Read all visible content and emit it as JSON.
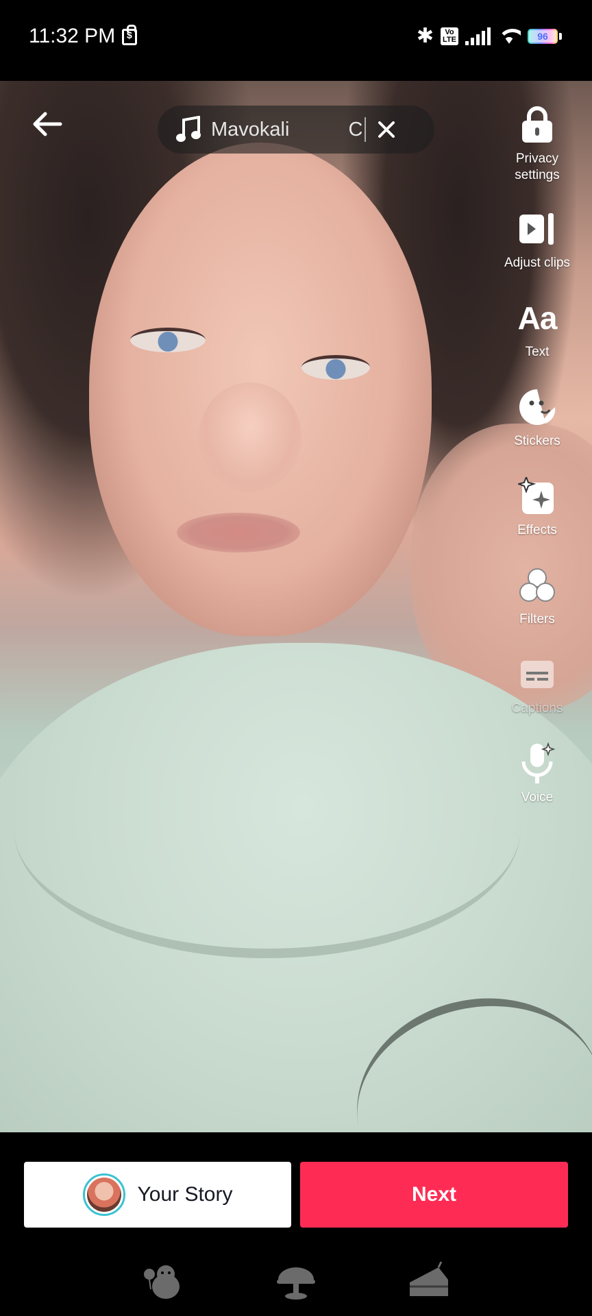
{
  "status_bar": {
    "time": "11:32 PM",
    "volte": "Vo LTE",
    "battery_level": "96"
  },
  "music": {
    "title": "Mavokali",
    "title_overflow": "Co"
  },
  "tools": [
    {
      "name": "privacy-settings",
      "label": "Privacy\nsettings",
      "icon": "lock-icon"
    },
    {
      "name": "adjust-clips",
      "label": "Adjust clips",
      "icon": "adjust-clips-icon"
    },
    {
      "name": "text",
      "label": "Text",
      "icon": "text-icon",
      "glyph": "Aa"
    },
    {
      "name": "stickers",
      "label": "Stickers",
      "icon": "sticker-icon"
    },
    {
      "name": "effects",
      "label": "Effects",
      "icon": "effects-icon"
    },
    {
      "name": "filters",
      "label": "Filters",
      "icon": "filters-icon"
    },
    {
      "name": "captions",
      "label": "Captions",
      "icon": "captions-icon",
      "disabled": true
    },
    {
      "name": "voice",
      "label": "Voice",
      "icon": "voice-icon"
    }
  ],
  "actions": {
    "story_label": "Your Story",
    "next_label": "Next"
  },
  "colors": {
    "accent": "#fe2c55",
    "story_ring": "#3bc2d1"
  }
}
